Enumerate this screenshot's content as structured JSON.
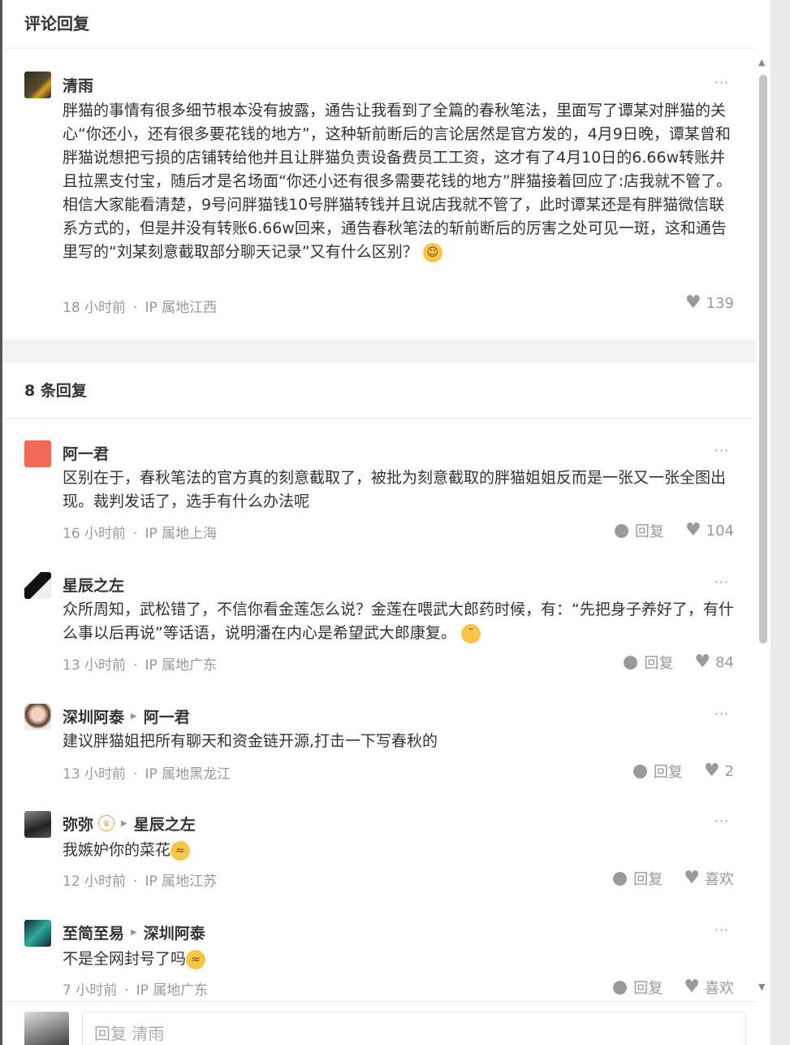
{
  "header": {
    "title": "评论回复"
  },
  "main_comment": {
    "author": "清雨",
    "text": "胖猫的事情有很多细节根本没有披露，通告让我看到了全篇的春秋笔法，里面写了谭某对胖猫的关心“你还小，还有很多要花钱的地方”，这种斩前断后的言论居然是官方发的，4月9日晚，谭某曾和胖猫说想把亏损的店铺转给他并且让胖猫负责设备费员工工资，这才有了4月10日的6.66w转账并且拉黑支付宝，随后才是名场面“你还小还有很多需要花钱的地方”胖猫接着回应了:店我就不管了。相信大家能看清楚，9号问胖猫钱10号胖猫转钱并且说店我就不管了，此时谭某还是有胖猫微信联系方式的，但是并没有转账6.66w回来，通告春秋笔法的斩前断后的厉害之处可见一斑，这和通告里写的“刘某刻意截取部分聊天记录”又有什么区别？",
    "emoji": "grinning-emoji",
    "time": "18 小时前",
    "ip": "IP 属地江西",
    "likes": "139"
  },
  "replies_header": "8 条回复",
  "reply_label": "回复",
  "more_label": "···",
  "replies": [
    {
      "author": "阿一君",
      "text": "区别在于，春秋笔法的官方真的刻意截取了，被批为刻意截取的胖猫姐姐反而是一张又一张全图出现。裁判发话了，选手有什么办法呢",
      "time": "16 小时前",
      "ip": "IP 属地上海",
      "likes": "104"
    },
    {
      "author": "星辰之左",
      "text": "众所周知，武松错了，不信你看金莲怎么说？金莲在喂武大郎药时候，有：“先把身子养好了，有什么事以后再说”等话语，说明潘在内心是希望武大郎康复。",
      "time": "13 小时前",
      "ip": "IP 属地广东",
      "likes": "84"
    },
    {
      "author": "深圳阿泰",
      "reply_to": "阿一君",
      "text": "建议胖猫姐把所有聊天和资金链开源,打击一下写春秋的",
      "time": "13 小时前",
      "ip": "IP 属地黑龙江",
      "likes": "2"
    },
    {
      "author": "弥弥",
      "reply_to": "星辰之左",
      "text": "我嫉妒你的菜花",
      "time": "12 小时前",
      "ip": "IP 属地江苏",
      "likes": "喜欢"
    },
    {
      "author": "至简至易",
      "reply_to": "深圳阿泰",
      "text": "不是全网封号了吗",
      "time": "7 小时前",
      "ip": "IP 属地广东",
      "likes": "喜欢"
    }
  ],
  "input": {
    "placeholder": "回复 清雨"
  },
  "colors": {
    "accent": "#333333",
    "muted": "#999999",
    "divider": "#f2f2f2"
  }
}
